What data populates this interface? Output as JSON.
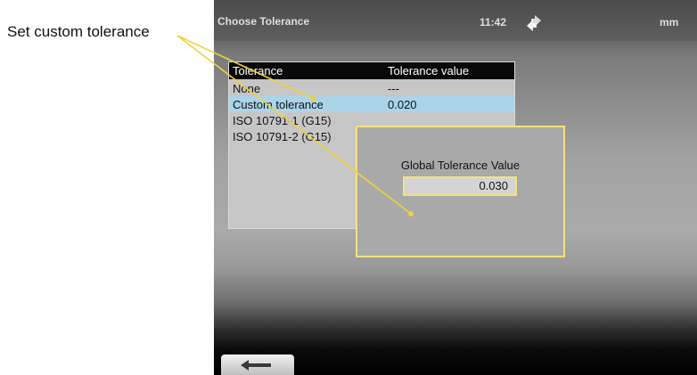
{
  "callout": {
    "label": "Set custom tolerance"
  },
  "status_bar": {
    "title": "Choose Tolerance",
    "time": "11:42",
    "unit": "mm"
  },
  "table": {
    "headers": [
      "Tolerance",
      "Tolerance value"
    ],
    "rows": [
      {
        "name": "None",
        "value": "---"
      },
      {
        "name": "Custom tolerance",
        "value": "0.020"
      },
      {
        "name": "ISO 10791-1 (G15)",
        "value": ""
      },
      {
        "name": "ISO 10791-2 (G15)",
        "value": ""
      }
    ],
    "selected_index": 1
  },
  "dialog": {
    "label": "Global Tolerance Value",
    "value": "0.030"
  },
  "colors": {
    "selected_row": "#a9d4ea",
    "dialog_border": "#f3e37a",
    "callout_line": "#f0d23c",
    "header_bg": "#090909"
  },
  "icons": {
    "status": "orientation-arrows-icon",
    "back": "back-arrow-icon"
  }
}
